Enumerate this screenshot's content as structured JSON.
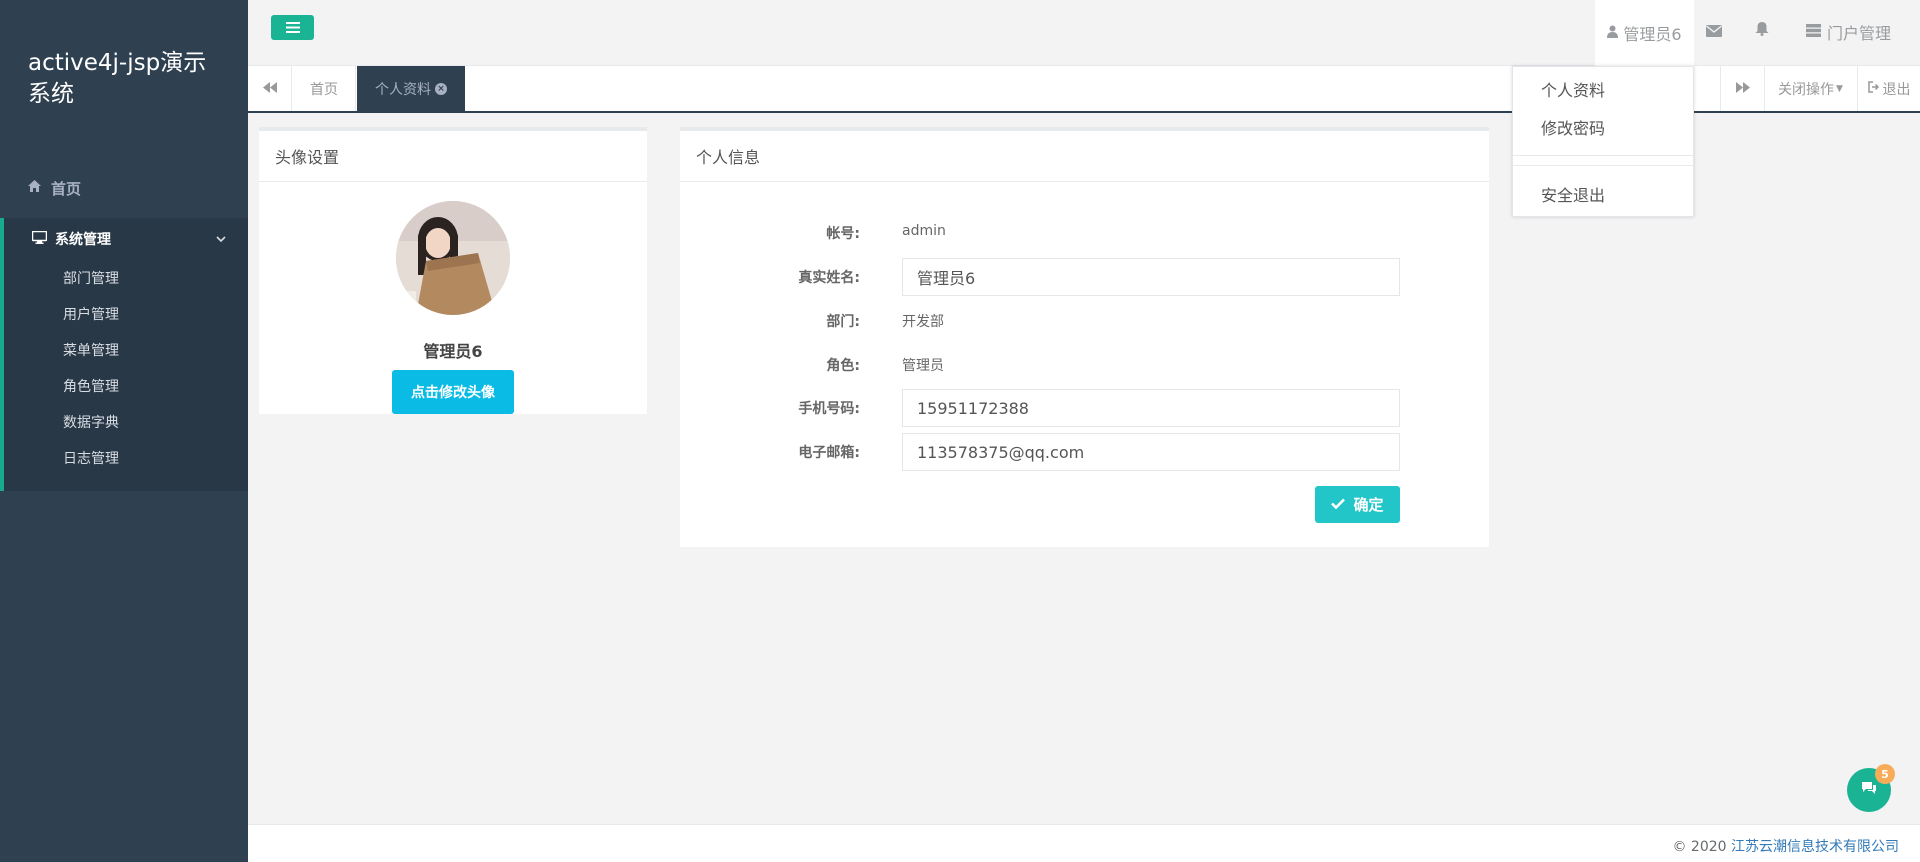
{
  "sidebar": {
    "brand": "active4j-jsp演示系统",
    "home_label": "首页",
    "group_label": "系统管理",
    "items": [
      {
        "label": "部门管理"
      },
      {
        "label": "用户管理"
      },
      {
        "label": "菜单管理"
      },
      {
        "label": "角色管理"
      },
      {
        "label": "数据字典"
      },
      {
        "label": "日志管理"
      }
    ]
  },
  "header": {
    "user_name": "管理员6",
    "portal_label": "门户管理"
  },
  "tabs": {
    "home_label": "首页",
    "active_label": "个人资料",
    "close_ops_label": "关闭操作",
    "logout_label": "退出"
  },
  "avatar_panel": {
    "title": "头像设置",
    "name": "管理员6",
    "button_label": "点击修改头像"
  },
  "info_panel": {
    "title": "个人信息",
    "account_label": "帐号:",
    "account_value": "admin",
    "realname_label": "真实姓名:",
    "realname_value": "管理员6",
    "dept_label": "部门:",
    "dept_value": "开发部",
    "role_label": "角色:",
    "role_value": "管理员",
    "phone_label": "手机号码:",
    "phone_value": "15951172388",
    "email_label": "电子邮箱:",
    "email_value": "113578375@qq.com",
    "confirm_label": "确定"
  },
  "dropdown": {
    "profile_label": "个人资料",
    "password_label": "修改密码",
    "logout_label": "安全退出"
  },
  "footer": {
    "copyright": "© 2020 ",
    "company": "江苏云潮信息技术有限公司"
  },
  "chat": {
    "badge_count": "5"
  },
  "colors": {
    "sidebar_bg": "#2f4050",
    "accent_green": "#1ab394",
    "avatar_button": "#0abbe6",
    "confirm_button": "#23c6c8",
    "badge_orange": "#f8ac59"
  }
}
